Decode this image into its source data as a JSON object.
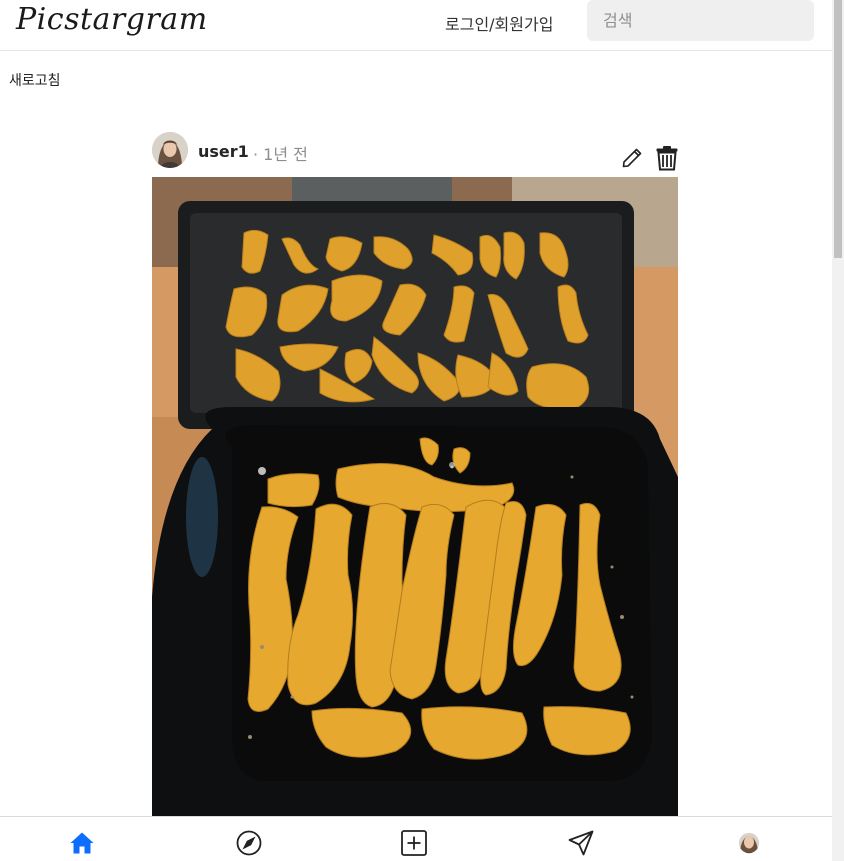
{
  "header": {
    "logo": "Picstargram",
    "login_label": "로그인/회원가입",
    "search_placeholder": "검색"
  },
  "toolbar": {
    "refresh_label": "새로고침"
  },
  "post": {
    "username": "user1",
    "time": "· 1년 전",
    "edit_icon": "pencil-icon",
    "delete_icon": "trash-icon"
  },
  "bottom_nav": {
    "items": [
      "home-icon",
      "explore-icon",
      "create-icon",
      "messages-icon",
      "profile-avatar"
    ],
    "active_color": "#0d6efd"
  },
  "colors": {
    "accent": "#0d6efd",
    "muted_text": "#8e8e8e",
    "search_bg": "#efefef"
  }
}
